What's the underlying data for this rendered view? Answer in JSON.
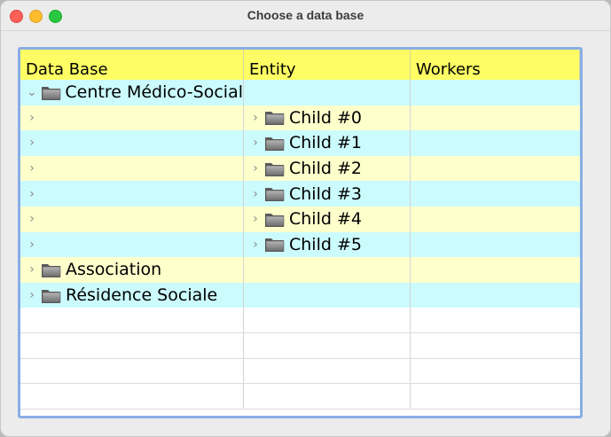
{
  "window": {
    "title": "Choose a data base"
  },
  "columns": [
    "Data Base",
    "Entity",
    "Workers"
  ],
  "rows": [
    {
      "style": "cyan",
      "c1": {
        "chevron": "⌄",
        "folder": true,
        "label": "Centre Médico-Social"
      },
      "c2": null,
      "c3": ""
    },
    {
      "style": "yellow",
      "c1": {
        "chevron": "›",
        "folder": false,
        "label": ""
      },
      "c2": {
        "chevron": "›",
        "folder": true,
        "label": "Child #0"
      },
      "c3": ""
    },
    {
      "style": "cyan",
      "c1": {
        "chevron": "›",
        "folder": false,
        "label": ""
      },
      "c2": {
        "chevron": "›",
        "folder": true,
        "label": "Child #1"
      },
      "c3": ""
    },
    {
      "style": "yellow",
      "c1": {
        "chevron": "›",
        "folder": false,
        "label": ""
      },
      "c2": {
        "chevron": "›",
        "folder": true,
        "label": "Child #2"
      },
      "c3": ""
    },
    {
      "style": "cyan",
      "c1": {
        "chevron": "›",
        "folder": false,
        "label": ""
      },
      "c2": {
        "chevron": "›",
        "folder": true,
        "label": "Child #3"
      },
      "c3": ""
    },
    {
      "style": "yellow",
      "c1": {
        "chevron": "›",
        "folder": false,
        "label": ""
      },
      "c2": {
        "chevron": "›",
        "folder": true,
        "label": "Child #4"
      },
      "c3": ""
    },
    {
      "style": "cyan",
      "c1": {
        "chevron": "›",
        "folder": false,
        "label": ""
      },
      "c2": {
        "chevron": "›",
        "folder": true,
        "label": "Child #5"
      },
      "c3": ""
    },
    {
      "style": "yellow",
      "c1": {
        "chevron": "›",
        "folder": true,
        "label": "Association"
      },
      "c2": null,
      "c3": ""
    },
    {
      "style": "cyan",
      "c1": {
        "chevron": "›",
        "folder": true,
        "label": "Résidence Sociale"
      },
      "c2": null,
      "c3": ""
    }
  ],
  "empty_rows": 4,
  "colors": {
    "header": "#fefe64",
    "row_cyan": "#cbfbfd",
    "row_yellow": "#ffffcc",
    "frame_border": "#89aee6"
  },
  "icons": {
    "folder": "folder-icon",
    "expanded": "chevron-down-icon",
    "collapsed": "chevron-right-icon"
  }
}
